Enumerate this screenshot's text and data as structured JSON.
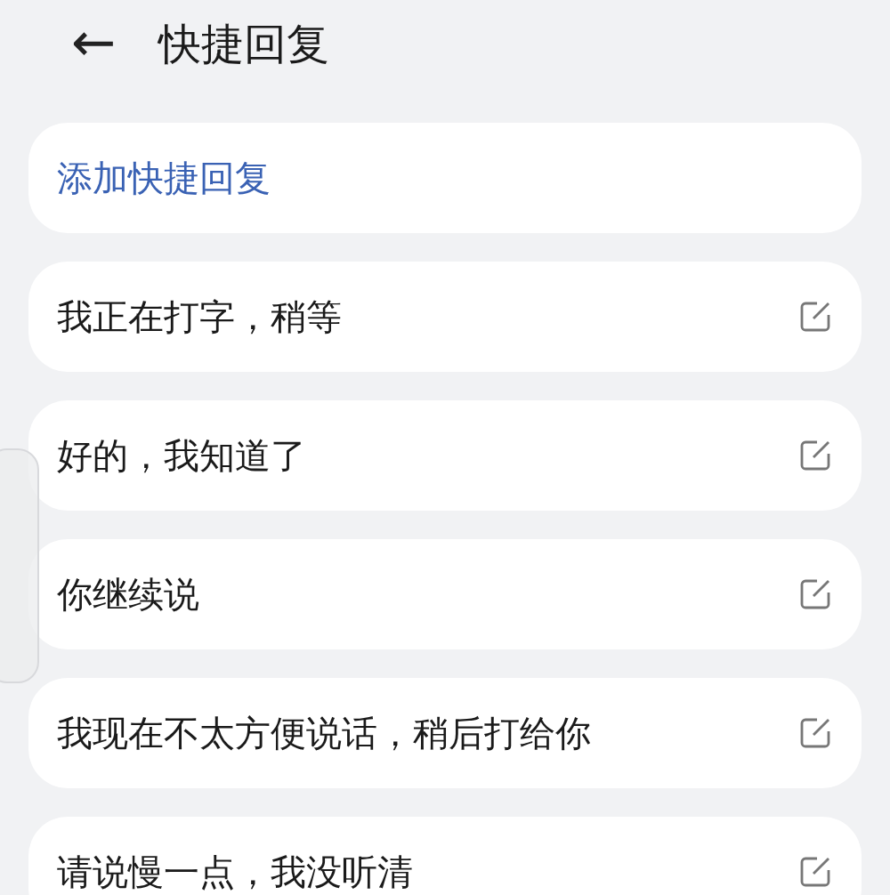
{
  "header": {
    "back": "←",
    "title": "快捷回复"
  },
  "add_button": {
    "label": "添加快捷回复"
  },
  "replies": [
    {
      "text": "我正在打字，稍等"
    },
    {
      "text": "好的，我知道了"
    },
    {
      "text": "你继续说"
    },
    {
      "text": "我现在不太方便说话，稍后打给你"
    },
    {
      "text": "请说慢一点，我没听清"
    }
  ]
}
